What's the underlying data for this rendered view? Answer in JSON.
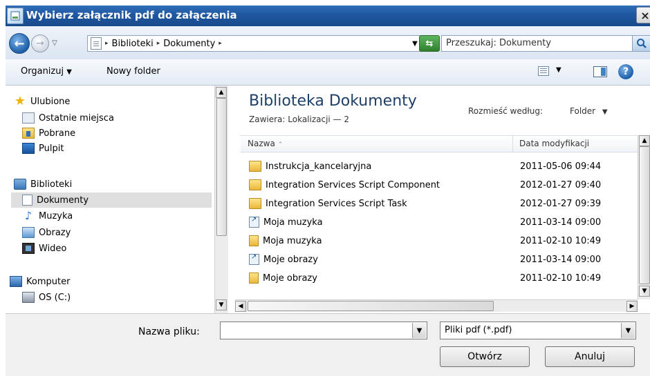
{
  "window": {
    "title": "Wybierz załącznik pdf do załączenia",
    "close_label": "×"
  },
  "address": {
    "crumbs": [
      "Biblioteki",
      "Dokumenty"
    ],
    "search_placeholder": "Przeszukaj: Dokumenty"
  },
  "toolbar": {
    "organize_label": "Organizuj",
    "new_folder_label": "Nowy folder"
  },
  "nav": {
    "items": [
      {
        "label": "Ulubione",
        "icon": "star-icon"
      },
      {
        "label": "Ostatnie miejsca",
        "icon": "recent-places-icon"
      },
      {
        "label": "Pobrane",
        "icon": "downloads-icon"
      },
      {
        "label": "Pulpit",
        "icon": "desktop-icon"
      },
      {
        "label": "Biblioteki",
        "icon": "libraries-icon"
      },
      {
        "label": "Dokumenty",
        "icon": "documents-icon",
        "selected": true
      },
      {
        "label": "Muzyka",
        "icon": "music-icon"
      },
      {
        "label": "Obrazy",
        "icon": "pictures-icon"
      },
      {
        "label": "Wideo",
        "icon": "video-icon"
      },
      {
        "label": "Komputer",
        "icon": "computer-icon"
      },
      {
        "label": "OS (C:)",
        "icon": "drive-icon"
      }
    ]
  },
  "content": {
    "title": "Biblioteka Dokumenty",
    "subtitle_prefix": "Zawiera:",
    "subtitle_link": "Lokalizacji — 2",
    "arrange_label": "Rozmieść według:",
    "arrange_value": "Folder",
    "columns": {
      "name": "Nazwa",
      "date": "Data modyfikacji"
    },
    "files": [
      {
        "name": "Instrukcja_kancelaryjna",
        "date": "2011-05-06 09:44",
        "icon": "folder-icon"
      },
      {
        "name": "Integration Services Script Component",
        "date": "2012-01-27 09:40",
        "icon": "folder-icon"
      },
      {
        "name": "Integration Services Script Task",
        "date": "2012-01-27 09:39",
        "icon": "folder-icon"
      },
      {
        "name": "Moja muzyka",
        "date": "2011-03-14 09:00",
        "icon": "shortcut-icon"
      },
      {
        "name": "Moja muzyka",
        "date": "2011-02-10 10:49",
        "icon": "locked-folder-icon"
      },
      {
        "name": "Moje obrazy",
        "date": "2011-03-14 09:00",
        "icon": "shortcut-icon"
      },
      {
        "name": "Moje obrazy",
        "date": "2011-02-10 10:49",
        "icon": "locked-folder-icon"
      }
    ]
  },
  "bottom": {
    "filename_label": "Nazwa pliku:",
    "filename_value": "",
    "filetype_value": "Pliki pdf (*.pdf)",
    "open_label": "Otwórz",
    "cancel_label": "Anuluj"
  }
}
